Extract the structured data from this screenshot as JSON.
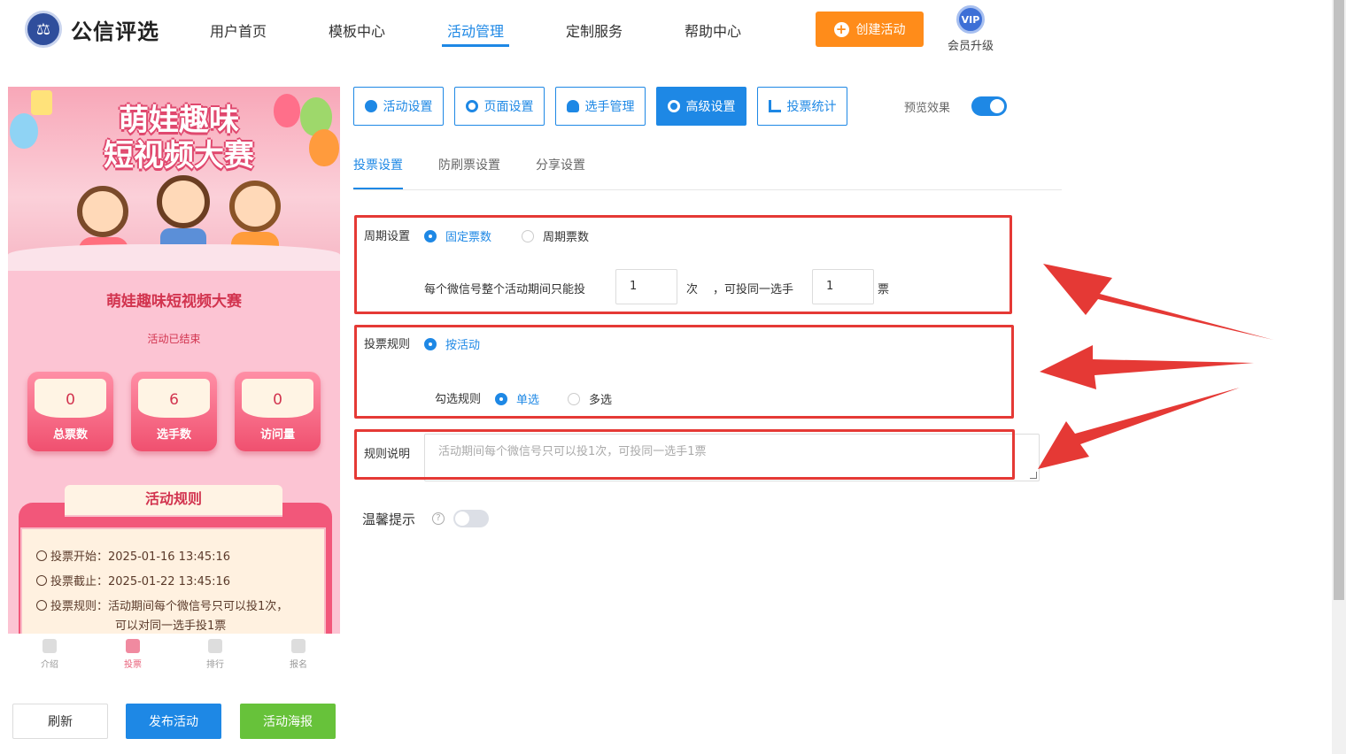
{
  "header": {
    "logo_text": "公信评选",
    "nav": [
      "用户首页",
      "模板中心",
      "活动管理",
      "定制服务",
      "帮助中心"
    ],
    "active_nav": "活动管理",
    "create_button": "创建活动",
    "vip_badge": "VIP",
    "vip_label": "会员升级"
  },
  "preview": {
    "banner_title_line1": "萌娃趣味",
    "banner_title_line2": "短视频大赛",
    "title": "萌娃趣味短视频大赛",
    "status": "活动已结束",
    "stats": [
      {
        "value": "0",
        "label": "总票数"
      },
      {
        "value": "6",
        "label": "选手数"
      },
      {
        "value": "0",
        "label": "访问量"
      }
    ],
    "rules_title": "活动规则",
    "rules": {
      "start": "投票开始：2025-01-16 13:45:16",
      "end": "投票截止：2025-01-22 13:45:16",
      "rule_line1": "投票规则：活动期间每个微信号只可以投1次，",
      "rule_line2": "可以对同一选手投1票"
    },
    "tabbar": [
      "介绍",
      "投票",
      "排行",
      "报名"
    ],
    "active_tab": "投票",
    "buttons": {
      "refresh": "刷新",
      "publish": "发布活动",
      "poster": "活动海报"
    }
  },
  "settings": {
    "top_tabs": [
      "活动设置",
      "页面设置",
      "选手管理",
      "高级设置",
      "投票统计"
    ],
    "active_top_tab": "高级设置",
    "preview_label": "预览效果",
    "preview_enabled": true,
    "sub_tabs": [
      "投票设置",
      "防刷票设置",
      "分享设置"
    ],
    "active_sub_tab": "投票设置",
    "period": {
      "label": "周期设置",
      "option_fixed": "固定票数",
      "option_cycle": "周期票数",
      "selected": "固定票数",
      "sentence_prefix": "每个微信号整个活动期间只能投",
      "times_value": "1",
      "times_unit": "次",
      "sentence_middle": "，可投同一选手",
      "votes_value": "1",
      "votes_unit": "票"
    },
    "vote_rule": {
      "label": "投票规则",
      "option_activity": "按活动",
      "check_label": "勾选规则",
      "option_single": "单选",
      "option_multi": "多选",
      "selected_check": "单选"
    },
    "rule_desc": {
      "label": "规则说明",
      "placeholder": "活动期间每个微信号只可以投1次，可投同一选手1票"
    },
    "warm_tip": {
      "label": "温馨提示",
      "help": "?",
      "enabled": false
    }
  },
  "colors": {
    "accent": "#1e88e5",
    "orange": "#ff8c1a",
    "green": "#67c23a",
    "annotation_red": "#e53935"
  }
}
